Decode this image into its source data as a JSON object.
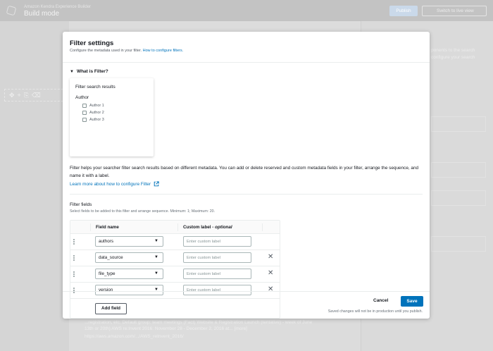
{
  "app": {
    "subtitle": "Amazon Kendra Experience Builder",
    "title": "Build mode",
    "publish_label": "Publish",
    "live_label": "Switch to live view"
  },
  "background": {
    "right_panel_lines": [
      "ponents to the search",
      "configure your search"
    ],
    "bottom_text": "...registration, etc. Default group: team meetings (Fact) Website & Registration Launch (tentative) - week of June",
    "bottom_text_2": "13th or 20th) AWS re:Invent 2016: November 28 - December 2, 2016 at... [more]",
    "bottom_url": "https://aws.amazon.com/.../AWS_reInvent_2016/"
  },
  "modal": {
    "title": "Filter settings",
    "description": "Configure the metadata used in your filter.",
    "description_link": "How to configure filters.",
    "expander_label": "What is Filter?",
    "preview": {
      "title": "Filter search results",
      "group": "Author",
      "options": [
        "Author 1",
        "Author 2",
        "Author 3"
      ]
    },
    "explanation": "Filter helps your searcher filter search results based on different metadata. You can add or delete reserved and custom metadata fields in your filter, arrange the sequence, and name it with a label.",
    "learn_more": "Learn more about how to configure Filter",
    "fields_label": "Filter fields",
    "fields_description": "Select fields to be added to this filter and arrange sequence. Minimum: 1; Maximum: 20.",
    "columns": {
      "field_name": "Field name",
      "custom_label": "Custom label",
      "optional": "optional"
    },
    "rows": [
      {
        "field": "authors",
        "placeholder": "Enter custom label",
        "removable": false
      },
      {
        "field": "data_source",
        "placeholder": "Enter custom label",
        "removable": true
      },
      {
        "field": "file_type",
        "placeholder": "Enter custom label",
        "removable": true
      },
      {
        "field": "version",
        "placeholder": "Enter custom label",
        "removable": true
      }
    ],
    "add_field_label": "Add field",
    "cancel_label": "Cancel",
    "save_label": "Save",
    "footnote": "Saved changes will not be in production until you publish."
  },
  "colors": {
    "primary": "#0073bb",
    "text": "#16191f",
    "muted": "#687078"
  }
}
